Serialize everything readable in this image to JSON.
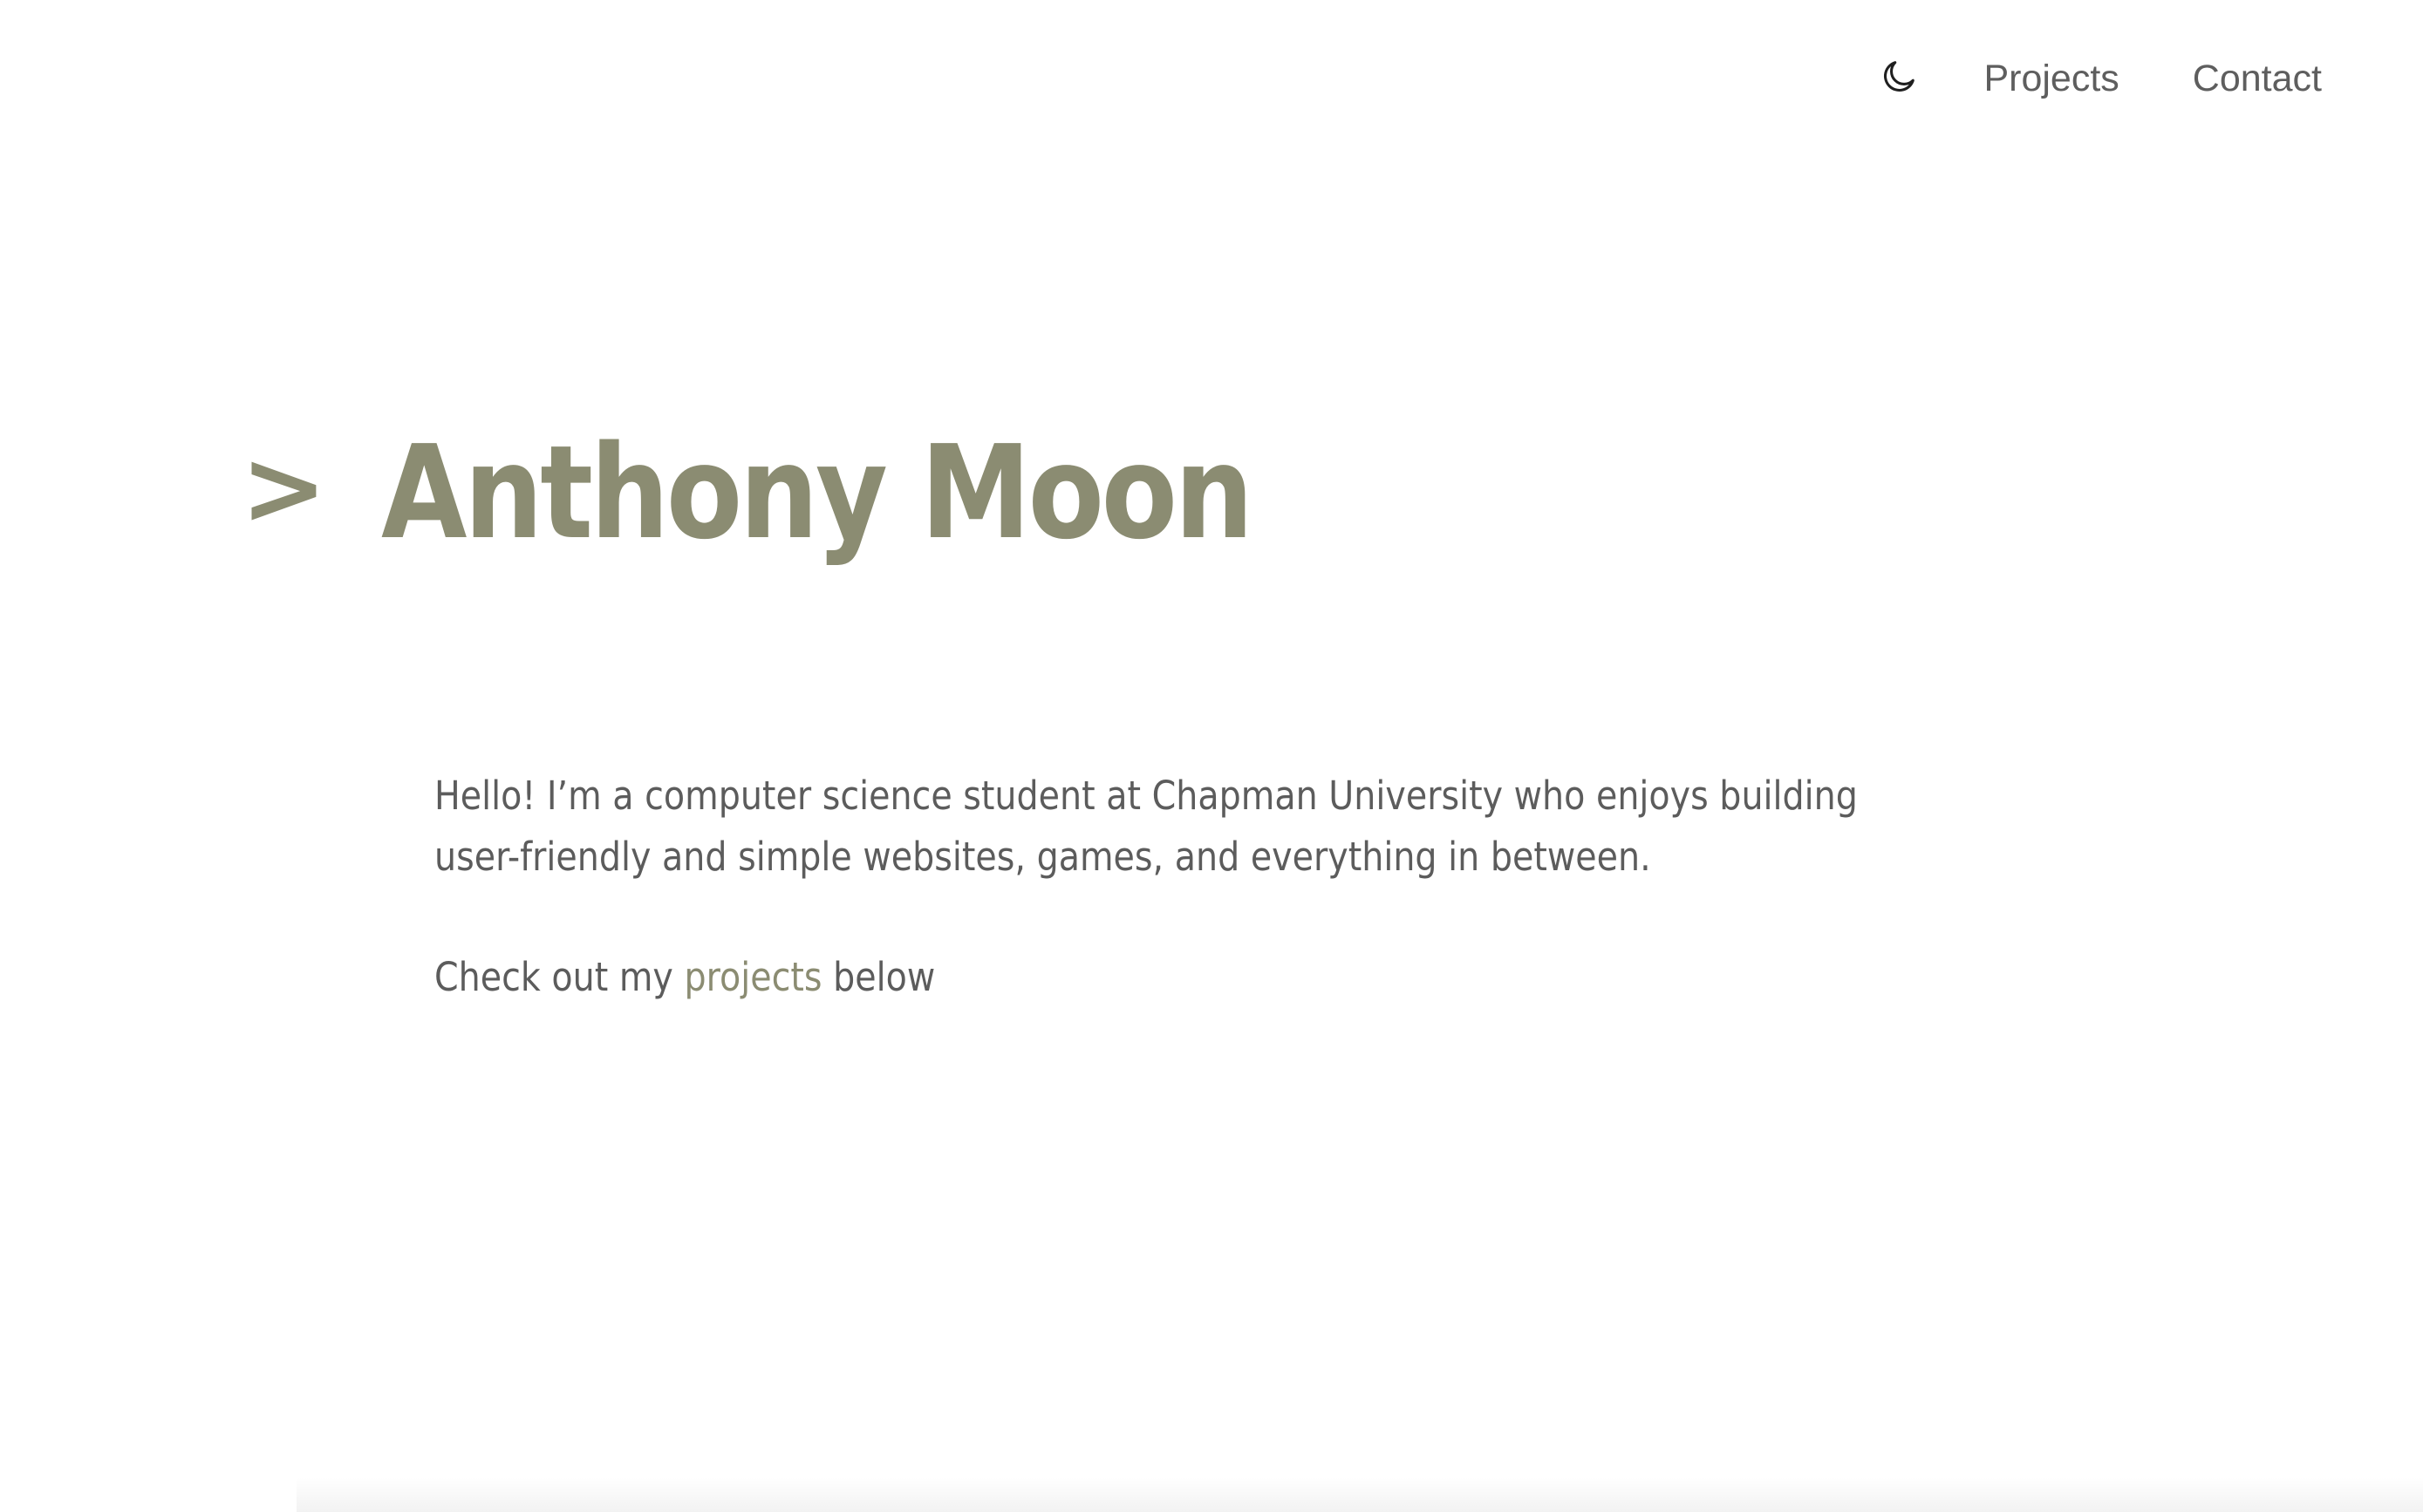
{
  "nav": {
    "theme_icon": "moon-icon",
    "items": [
      {
        "label": "Projects"
      },
      {
        "label": "Contact"
      }
    ]
  },
  "hero": {
    "prompt": ">",
    "title": "Anthony Moon"
  },
  "intro": {
    "paragraph1": "Hello! I’m a computer science student at Chapman University who enjoys building user-friendly and simple websites, games, and everything in between.",
    "paragraph2_before": "Check out my ",
    "paragraph2_link": "projects",
    "paragraph2_after": " below"
  },
  "colors": {
    "accent": "#8b8c72",
    "text": "#5c5c5c",
    "background": "#ffffff"
  }
}
